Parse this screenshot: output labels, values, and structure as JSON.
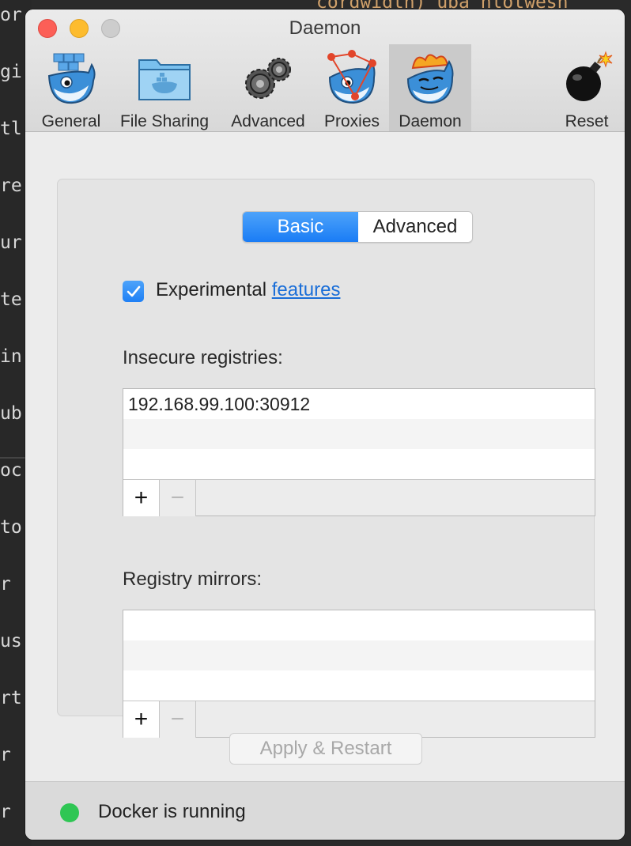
{
  "background_editor": {
    "top_fragment": "cordwidth)\"uba\"hlotwesh",
    "lines": [
      "or",
      "gi",
      "tl",
      "re",
      "ur",
      "te",
      "in",
      "ub",
      "oc",
      "to",
      "r",
      "us",
      "rt",
      "r",
      "r"
    ]
  },
  "window": {
    "title": "Daemon"
  },
  "toolbar": {
    "items": [
      {
        "label": "General",
        "icon": "docker-whale-icon"
      },
      {
        "label": "File Sharing",
        "icon": "folder-whale-icon"
      },
      {
        "label": "Advanced",
        "icon": "gears-icon"
      },
      {
        "label": "Proxies",
        "icon": "proxy-whale-icon"
      },
      {
        "label": "Daemon",
        "icon": "daemon-whale-icon",
        "active": true
      },
      {
        "label": "Reset",
        "icon": "bomb-icon"
      }
    ]
  },
  "tabs": {
    "basic": "Basic",
    "advanced": "Advanced",
    "selected": "Basic"
  },
  "experimental": {
    "checked": true,
    "label": "Experimental",
    "link": "features"
  },
  "insecure_registries": {
    "label": "Insecure registries:",
    "entries": [
      "192.168.99.100:30912"
    ]
  },
  "registry_mirrors": {
    "label": "Registry mirrors:",
    "entries": []
  },
  "list_controls": {
    "add": "+",
    "remove": "−"
  },
  "apply_button": "Apply & Restart",
  "status": {
    "text": "Docker is running",
    "color": "#2fc654"
  },
  "colors": {
    "accent": "#1a7cf5",
    "link": "#1a6ed8"
  }
}
